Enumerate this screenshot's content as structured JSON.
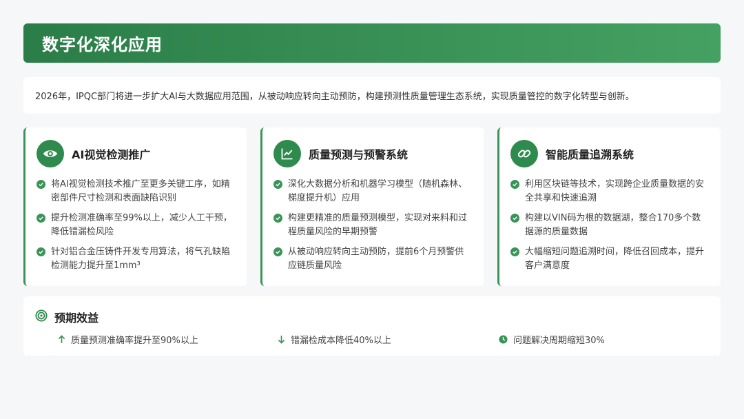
{
  "header": {
    "title": "数字化深化应用"
  },
  "intro": {
    "text": "2026年，IPQC部门将进一步扩大AI与大数据应用范围，从被动响应转向主动预防，构建预测性质量管理生态系统，实现质量管控的数字化转型与创新。"
  },
  "cards": [
    {
      "icon": "eye-icon",
      "title": "AI视觉检测推广",
      "bullets": [
        "将AI视觉检测技术推广至更多关键工序，如精密部件尺寸检测和表面缺陷识别",
        "提升检测准确率至99%以上，减少人工干预，降低错漏检风险",
        "针对铝合金压铸件开发专用算法，将气孔缺陷检测能力提升至1mm³"
      ]
    },
    {
      "icon": "chart-line-icon",
      "title": "质量预测与预警系统",
      "bullets": [
        "深化大数据分析和机器学习模型（随机森林、梯度提升机）应用",
        "构建更精准的质量预测模型，实现对来料和过程质量风险的早期预警",
        "从被动响应转向主动预防，提前6个月预警供应链质量风险"
      ]
    },
    {
      "icon": "link-icon",
      "title": "智能质量追溯系统",
      "bullets": [
        "利用区块链等技术，实现跨企业质量数据的安全共享和快速追溯",
        "构建以VIN码为根的数据湖，整合170多个数据源的质量数据",
        "大幅缩短问题追溯时间，降低召回成本，提升客户满意度"
      ]
    }
  ],
  "benefits": {
    "icon": "target-icon",
    "title": "预期效益",
    "items": [
      {
        "icon": "arrow-up-icon",
        "text": "质量预测准确率提升至90%以上"
      },
      {
        "icon": "arrow-down-icon",
        "text": "错漏检成本降低40%以上"
      },
      {
        "icon": "clock-icon",
        "text": "问题解决周期缩短30%"
      }
    ]
  },
  "colors": {
    "accent": "#3a9457",
    "header_start": "#2b7d48",
    "header_end": "#45a162"
  }
}
